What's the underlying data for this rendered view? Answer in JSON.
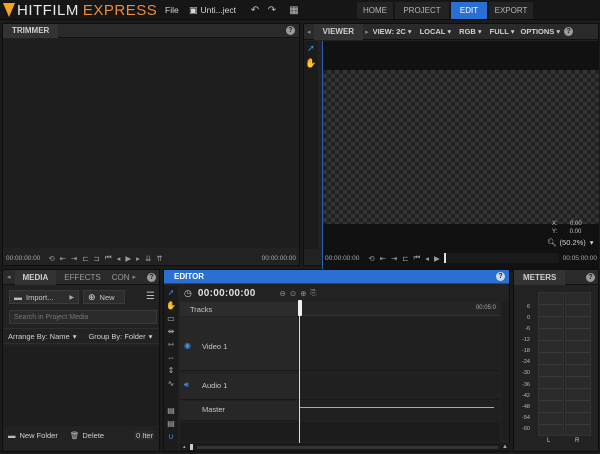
{
  "app": {
    "name_part1": "HITFILM",
    "name_part2": "EXPRESS"
  },
  "menu": {
    "file": "File",
    "project_name": "Unti...ject"
  },
  "icons": {
    "undo": "undo-icon",
    "redo": "redo-icon",
    "grid": "grid-menu-icon"
  },
  "tabs": [
    {
      "label": "HOME",
      "active": false
    },
    {
      "label": "PROJECT",
      "active": false
    },
    {
      "label": "EDIT",
      "active": true
    },
    {
      "label": "EXPORT",
      "active": false
    }
  ],
  "trimmer": {
    "title": "TRIMMER",
    "timecode_left": "00:00:00:00",
    "timecode_right": "00:00:00:00"
  },
  "viewer": {
    "title": "VIEWER",
    "view": "VIEW: 2C",
    "local": "LOCAL",
    "rgb": "RGB",
    "full": "FULL",
    "options": "OPTIONS",
    "x_label": "X:",
    "x_value": "0.00",
    "y_label": "Y:",
    "y_value": "0.00",
    "zoom": "(50.2%)",
    "timecode_left": "00:00:00:00",
    "timecode_right": "00:05:00:00"
  },
  "media": {
    "tabs": [
      "MEDIA",
      "EFFECTS",
      "CON"
    ],
    "import": "Import...",
    "new": "New",
    "search_placeholder": "Search in Project Media",
    "arrange": "Arrange By: Name",
    "group": "Group By: Folder",
    "new_folder": "New Folder",
    "delete": "Delete",
    "items": "0 Iter"
  },
  "editor": {
    "title": "EDITOR",
    "timecode": "00:00:00:00",
    "tracks_label": "Tracks",
    "ruler_end": "00:05:0",
    "video_track": "Video 1",
    "audio_track": "Audio 1",
    "master": "Master"
  },
  "meters": {
    "title": "METERS",
    "scale": [
      "6",
      "0",
      "-6",
      "-12",
      "-18",
      "-24",
      "-30",
      "-36",
      "-42",
      "-48",
      "-54",
      "-60"
    ],
    "left": "L",
    "right": "R"
  },
  "colors": {
    "accent": "#2a6fd4",
    "brand_orange": "#f08b3c",
    "logo_yellow": "#f3a521"
  }
}
